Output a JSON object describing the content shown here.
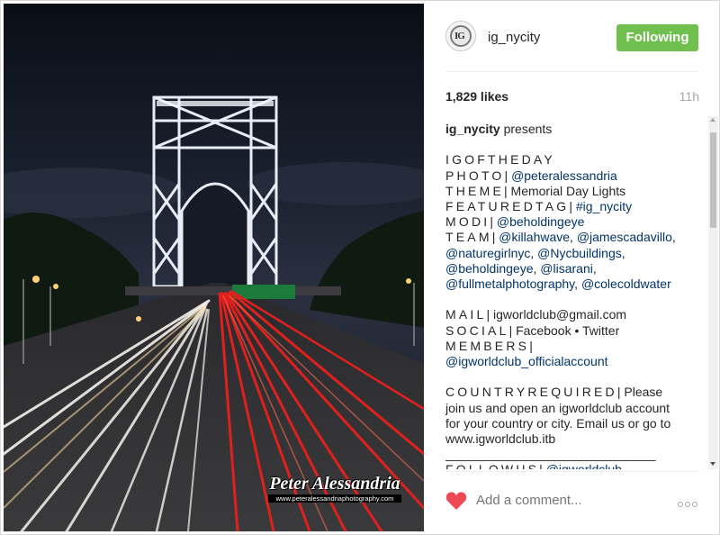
{
  "post": {
    "username": "ig_nycity",
    "follow_label": "Following",
    "likes": "1,829 likes",
    "time_ago": "11h",
    "caption_lines": [
      {
        "parts": [
          {
            "t": "ig_nycity",
            "k": "user"
          },
          {
            "t": " presents",
            "k": "text"
          }
        ]
      },
      {
        "gap": true
      },
      {
        "parts": [
          {
            "t": "IGOFTHEDAY",
            "k": "sp"
          }
        ]
      },
      {
        "parts": [
          {
            "t": "PHOTO",
            "k": "sp"
          },
          {
            "t": "| ",
            "k": "text"
          },
          {
            "t": "@peteralessandria",
            "k": "tag"
          }
        ]
      },
      {
        "parts": [
          {
            "t": "THEME",
            "k": "sp"
          },
          {
            "t": "| Memorial Day Lights",
            "k": "text"
          }
        ]
      },
      {
        "parts": [
          {
            "t": "FEATUREDTAG",
            "k": "sp"
          },
          {
            "t": "| ",
            "k": "text"
          },
          {
            "t": "#ig_nycity",
            "k": "tag"
          }
        ]
      },
      {
        "parts": [
          {
            "t": "MODI",
            "k": "sp"
          },
          {
            "t": "| ",
            "k": "text"
          },
          {
            "t": "@beholdingeye",
            "k": "tag"
          }
        ]
      },
      {
        "parts": [
          {
            "t": "TEAM",
            "k": "sp"
          },
          {
            "t": "| ",
            "k": "text"
          },
          {
            "t": "@killahwave",
            "k": "tag"
          },
          {
            "t": ", ",
            "k": "text"
          },
          {
            "t": "@jamescadavillo",
            "k": "tag"
          },
          {
            "t": ",",
            "k": "text"
          }
        ]
      },
      {
        "parts": [
          {
            "t": "@naturegirlnyc",
            "k": "tag"
          },
          {
            "t": ", ",
            "k": "text"
          },
          {
            "t": "@Nycbuildings",
            "k": "tag"
          },
          {
            "t": ",",
            "k": "text"
          }
        ]
      },
      {
        "parts": [
          {
            "t": "@beholdingeye",
            "k": "tag"
          },
          {
            "t": ", ",
            "k": "text"
          },
          {
            "t": "@lisarani",
            "k": "tag"
          },
          {
            "t": ",",
            "k": "text"
          }
        ]
      },
      {
        "parts": [
          {
            "t": "@fullmetalphotography",
            "k": "tag"
          },
          {
            "t": ", ",
            "k": "text"
          },
          {
            "t": "@colecoldwater",
            "k": "tag"
          }
        ]
      },
      {
        "gap": true
      },
      {
        "parts": [
          {
            "t": "MAIL",
            "k": "sp"
          },
          {
            "t": "| igworldclub@gmail.com",
            "k": "text"
          }
        ]
      },
      {
        "parts": [
          {
            "t": "SOCIAL",
            "k": "sp"
          },
          {
            "t": "| Facebook • Twitter",
            "k": "text"
          }
        ]
      },
      {
        "parts": [
          {
            "t": "MEMBERS",
            "k": "sp"
          },
          {
            "t": "|",
            "k": "text"
          }
        ]
      },
      {
        "parts": [
          {
            "t": "@igworldclub_officialaccount",
            "k": "tag"
          }
        ]
      },
      {
        "gap": true
      },
      {
        "parts": [
          {
            "t": "COUNTRYREQUIRED",
            "k": "sp"
          },
          {
            "t": "| Please",
            "k": "text"
          }
        ]
      },
      {
        "parts": [
          {
            "t": "join us and open an igworldclub account",
            "k": "text"
          }
        ]
      },
      {
        "parts": [
          {
            "t": "for your country or city. Email us or go to",
            "k": "text"
          }
        ]
      },
      {
        "parts": [
          {
            "t": "www.igworldclub.itb",
            "k": "text"
          }
        ]
      },
      {
        "parts": [
          {
            "t": "______________________________",
            "k": "text"
          }
        ]
      },
      {
        "parts": [
          {
            "t": "FOLLOWUS",
            "k": "sp"
          },
          {
            "t": "| ",
            "k": "text"
          },
          {
            "t": "@igworldclub",
            "k": "tag"
          }
        ]
      }
    ],
    "comment_placeholder": "Add a comment...",
    "more_icon": "ellipsis-icon",
    "like_icon": "heart-icon"
  },
  "photo": {
    "watermark_name": "Peter Alessandria",
    "watermark_url": "www.peteralessandriaphotography.com"
  },
  "colors": {
    "follow_button": "#70c050",
    "heart": "#ed4956",
    "link": "#003569",
    "muted": "#a5a7aa"
  }
}
